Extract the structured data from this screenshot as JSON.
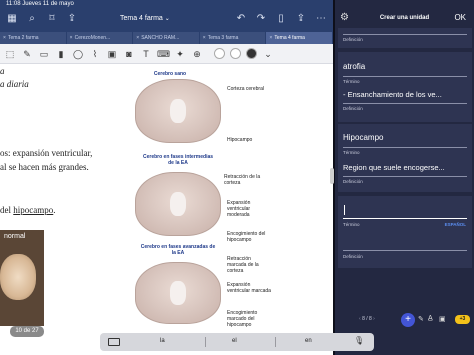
{
  "status_bar": {
    "time_date": "11:08   Jueves 11 de mayo"
  },
  "doc_app": {
    "title": "Tema 4 farma",
    "tabs": [
      {
        "label": "Tema 2 farma"
      },
      {
        "label": "CerezoMonen..."
      },
      {
        "label": "SANCHO RAM..."
      },
      {
        "label": "Tema 3 farma"
      },
      {
        "label": "Tema 4 farma"
      }
    ],
    "text_lines": [
      "a",
      "a diaria",
      "os: expansión ventricular,",
      "al se hacen más grandes.",
      "del",
      "hipocampo",
      "."
    ],
    "figure": {
      "healthy_title": "Cerebro sano",
      "early_title": "Cerebro en fases intermedias de la EA",
      "advanced_title": "Cerebro en fases avanzadas de la EA",
      "labels_healthy": [
        "Corteza cerebral",
        "Hipocampo"
      ],
      "labels_early": [
        "Retracción de la corteza",
        "Expansión ventricular moderada",
        "Encogimiento del hipocampo"
      ],
      "labels_advanced": [
        "Retracción marcada de la corteza",
        "Expansión ventricular marcada",
        "Encogimiento marcado del hipocampo"
      ]
    },
    "photo_label": "normal",
    "page_badge": "10 de 27",
    "toolbar_colors": [
      "#ffffff",
      "#ffffff",
      "#333333"
    ]
  },
  "flashcards": {
    "title": "Crear una unidad",
    "ok_label": "OK",
    "cards": [
      {
        "term": "",
        "definition": "",
        "definition_label": "Definición"
      },
      {
        "term": "atrofia",
        "term_label": "Término",
        "definition": "- Ensanchamiento de los ve...",
        "definition_label": "Definición"
      },
      {
        "term": "Hipocampo",
        "term_label": "Término",
        "definition": "Region que suele encogerse...",
        "definition_label": "Definición"
      },
      {
        "term": "",
        "term_label": "Término",
        "language": "ESPAÑOL",
        "definition": "",
        "definition_label": "Definición"
      }
    ],
    "counter": "8 / 8",
    "badge_label": "+3",
    "accent": "#4355d6"
  },
  "keyboard": {
    "suggestions": [
      "la",
      "el",
      "en"
    ]
  }
}
